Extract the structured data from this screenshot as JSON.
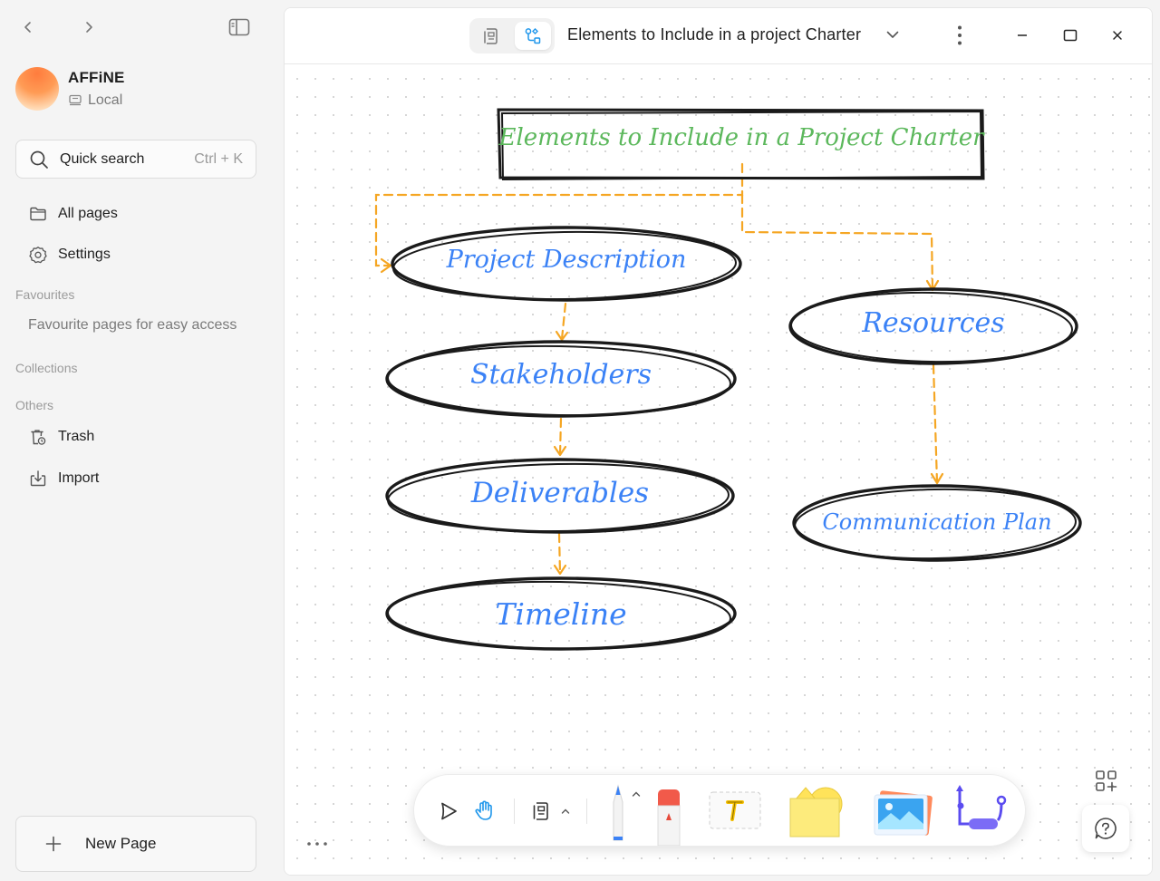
{
  "sidebar": {
    "workspace": {
      "name": "AFFiNE",
      "mode": "Local"
    },
    "search": {
      "label": "Quick search",
      "shortcut": "Ctrl + K"
    },
    "nav": {
      "all_pages": "All pages",
      "settings": "Settings"
    },
    "favourites": {
      "title": "Favourites",
      "empty": "Favourite pages for easy access"
    },
    "collections": {
      "title": "Collections"
    },
    "others": {
      "title": "Others",
      "trash": "Trash",
      "import": "Import"
    },
    "new_page": "New Page"
  },
  "header": {
    "title": "Elements to Include in a project Charter",
    "active_mode": "edgeless"
  },
  "canvas": {
    "title_box": "Elements to Include in a Project Charter",
    "nodes": {
      "project_description": "Project Description",
      "stakeholders": "Stakeholders",
      "deliverables": "Deliverables",
      "timeline": "Timeline",
      "resources": "Resources",
      "communication_plan": "Communication Plan"
    },
    "colors": {
      "title_text": "#5cb85c",
      "node_text": "#3b82f6",
      "outline": "#1a1a1a",
      "connector": "#f5a623"
    }
  },
  "toolbar": {
    "tools": [
      "select-tool",
      "hand-tool",
      "frame-tool",
      "pen-tool",
      "eraser-tool",
      "text-tool",
      "shape-tool",
      "image-tool",
      "connector-tool"
    ]
  }
}
